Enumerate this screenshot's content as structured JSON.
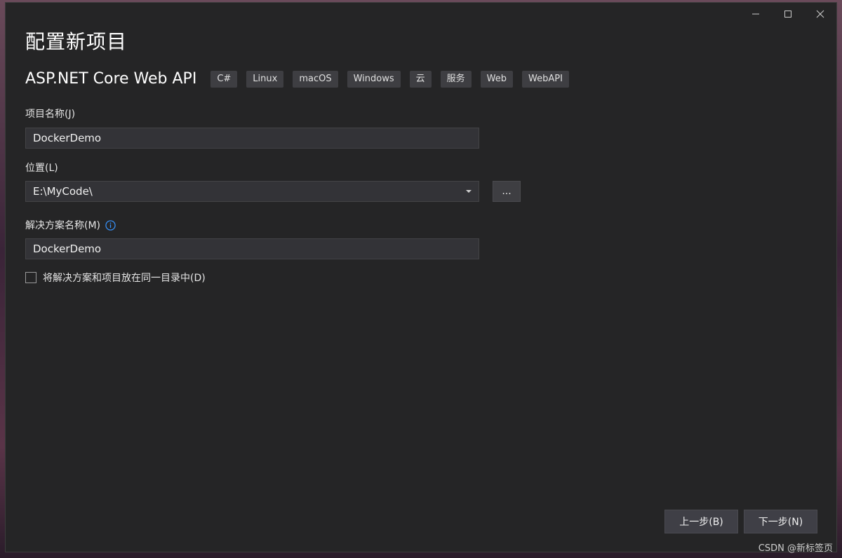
{
  "window": {
    "controls": {
      "minimize_icon": "minimize-icon",
      "maximize_icon": "maximize-icon",
      "close_icon": "close-icon"
    }
  },
  "header": {
    "title": "配置新项目"
  },
  "template": {
    "name": "ASP.NET Core Web API",
    "tags": [
      "C#",
      "Linux",
      "macOS",
      "Windows",
      "云",
      "服务",
      "Web",
      "WebAPI"
    ]
  },
  "form": {
    "project_name": {
      "label": "项目名称(J)",
      "value": "DockerDemo"
    },
    "location": {
      "label": "位置(L)",
      "value": "E:\\MyCode\\",
      "browse_label": "..."
    },
    "solution_name": {
      "label": "解决方案名称(M)",
      "value": "DockerDemo",
      "info_icon": "info-icon"
    },
    "same_directory": {
      "label": "将解决方案和项目放在同一目录中(D)",
      "checked": false
    }
  },
  "footer": {
    "back_label": "上一步(B)",
    "next_label": "下一步(N)"
  },
  "watermark": "CSDN @新标签页",
  "colors": {
    "window_bg": "#252526",
    "input_bg": "#333337",
    "tag_bg": "#3e3e42",
    "info_accent": "#3794ff"
  }
}
